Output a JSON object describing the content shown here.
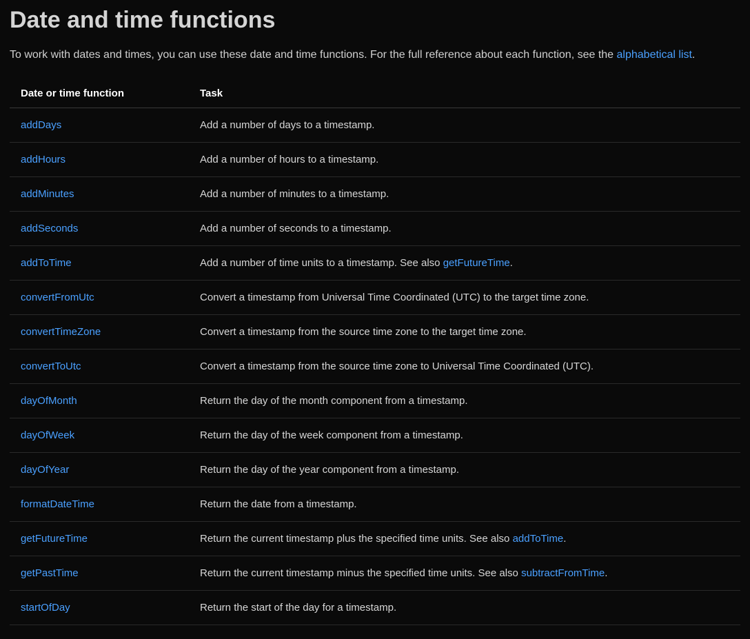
{
  "title": "Date and time functions",
  "intro": {
    "text_before": "To work with dates and times, you can use these date and time functions. For the full reference about each function, see the ",
    "link_text": "alphabetical list",
    "text_after": "."
  },
  "table": {
    "headers": {
      "col1": "Date or time function",
      "col2": "Task"
    },
    "rows": [
      {
        "fn": "addDays",
        "task_before": "Add a number of days to a timestamp.",
        "task_link": "",
        "task_after": ""
      },
      {
        "fn": "addHours",
        "task_before": "Add a number of hours to a timestamp.",
        "task_link": "",
        "task_after": ""
      },
      {
        "fn": "addMinutes",
        "task_before": "Add a number of minutes to a timestamp.",
        "task_link": "",
        "task_after": ""
      },
      {
        "fn": "addSeconds",
        "task_before": "Add a number of seconds to a timestamp.",
        "task_link": "",
        "task_after": ""
      },
      {
        "fn": "addToTime",
        "task_before": "Add a number of time units to a timestamp. See also ",
        "task_link": "getFutureTime",
        "task_after": "."
      },
      {
        "fn": "convertFromUtc",
        "task_before": "Convert a timestamp from Universal Time Coordinated (UTC) to the target time zone.",
        "task_link": "",
        "task_after": ""
      },
      {
        "fn": "convertTimeZone",
        "task_before": "Convert a timestamp from the source time zone to the target time zone.",
        "task_link": "",
        "task_after": ""
      },
      {
        "fn": "convertToUtc",
        "task_before": "Convert a timestamp from the source time zone to Universal Time Coordinated (UTC).",
        "task_link": "",
        "task_after": ""
      },
      {
        "fn": "dayOfMonth",
        "task_before": "Return the day of the month component from a timestamp.",
        "task_link": "",
        "task_after": ""
      },
      {
        "fn": "dayOfWeek",
        "task_before": "Return the day of the week component from a timestamp.",
        "task_link": "",
        "task_after": ""
      },
      {
        "fn": "dayOfYear",
        "task_before": "Return the day of the year component from a timestamp.",
        "task_link": "",
        "task_after": ""
      },
      {
        "fn": "formatDateTime",
        "task_before": "Return the date from a timestamp.",
        "task_link": "",
        "task_after": ""
      },
      {
        "fn": "getFutureTime",
        "task_before": "Return the current timestamp plus the specified time units. See also ",
        "task_link": "addToTime",
        "task_after": "."
      },
      {
        "fn": "getPastTime",
        "task_before": "Return the current timestamp minus the specified time units. See also ",
        "task_link": "subtractFromTime",
        "task_after": "."
      },
      {
        "fn": "startOfDay",
        "task_before": "Return the start of the day for a timestamp.",
        "task_link": "",
        "task_after": ""
      }
    ]
  }
}
